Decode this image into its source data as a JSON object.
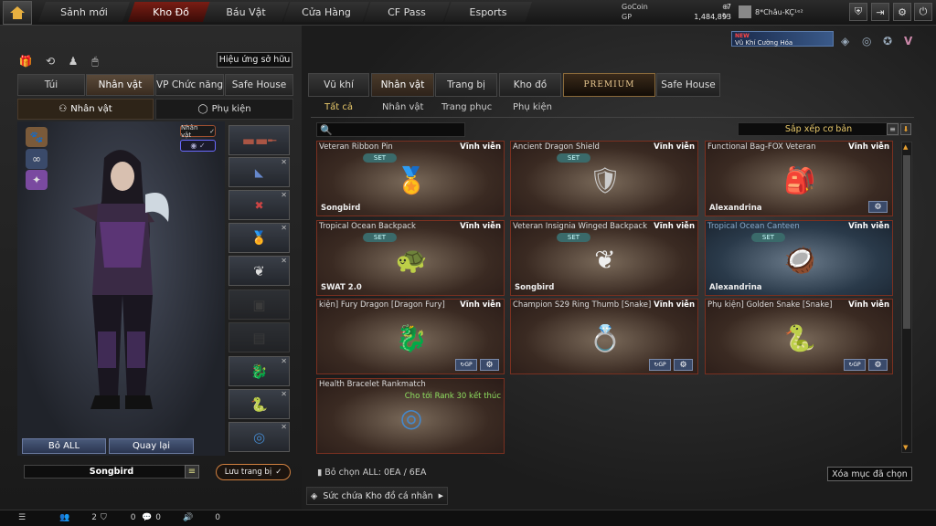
{
  "topnav": {
    "tabs": [
      {
        "label": "Sảnh mới"
      },
      {
        "label": "Kho Đồ"
      },
      {
        "label": "Báu Vật"
      },
      {
        "label": "Cửa Hàng"
      },
      {
        "label": "CF Pass"
      },
      {
        "label": "Esports"
      }
    ],
    "active_tab": "Kho Đồ"
  },
  "currency": {
    "gocoin_label": "GoCoin",
    "gocoin_value": "7",
    "gp_label": "GP",
    "gp_value": "1,484,893"
  },
  "player": {
    "name": "8*Châu-KÇ¹ᵉ²"
  },
  "promo": {
    "badge": "NEW",
    "label": "Vũ Khí Cường Hóa"
  },
  "left": {
    "effect_button": "Hiệu ứng sở hữu",
    "tabs": [
      "Túi",
      "Nhân vật",
      "VP Chức năng",
      "Safe House"
    ],
    "subtabs": [
      "Nhân vật",
      "Phụ kiện"
    ],
    "char_badge": "Nhân vật",
    "clear_all": "Bỏ ALL",
    "back": "Quay lại",
    "preset_name": "Songbird",
    "save": "Lưu trang bị"
  },
  "right": {
    "tabs": [
      "Vũ khí",
      "Nhân vật",
      "Trang bị",
      "Kho đồ"
    ],
    "premium": "PREMIUM",
    "safe_house": "Safe House",
    "subtabs": [
      "Tất cả",
      "Nhân vật",
      "Trang phục",
      "Phụ kiện"
    ],
    "sort": "Sắp xếp cơ bản",
    "select_count": "Bỏ chọn ALL: 0EA / 6EA",
    "clear_selected": "Xóa mục đã chọn",
    "capacity": "Sức chứa Kho đồ cá nhân"
  },
  "items": [
    {
      "name": "Veteran Ribbon Pin",
      "duration": "Vĩnh viễn",
      "set": "SET",
      "owner": "Songbird",
      "icon": "medal-icon"
    },
    {
      "name": "Ancient Dragon Shield",
      "duration": "Vĩnh viễn",
      "set": "SET",
      "owner": "",
      "icon": "shield-icon"
    },
    {
      "name": "Functional Bag-FOX Veteran",
      "duration": "Vĩnh viễn",
      "set": "",
      "owner": "Alexandrina",
      "icon": "backpack-icon"
    },
    {
      "name": "Tropical Ocean Backpack",
      "duration": "Vĩnh viễn",
      "set": "SET",
      "owner": "SWAT 2.0",
      "icon": "turtle-icon"
    },
    {
      "name": "Veteran Insignia Winged Backpack",
      "duration": "Vĩnh viễn",
      "set": "SET",
      "owner": "Songbird",
      "icon": "wings-icon"
    },
    {
      "name": "Tropical Ocean Canteen",
      "duration": "Vĩnh viễn",
      "set": "SET",
      "owner": "Alexandrina",
      "icon": "coconut-icon"
    },
    {
      "name": "kiện] Fury Dragon [Dragon Fury]",
      "duration": "Vĩnh viễn",
      "set": "",
      "owner": "",
      "icon": "dragon-icon"
    },
    {
      "name": "Champion S29 Ring Thumb [Snake]",
      "duration": "Vĩnh viễn",
      "set": "",
      "owner": "",
      "icon": "ring-icon"
    },
    {
      "name": "Phụ kiện] Golden Snake [Snake]",
      "duration": "Vĩnh viễn",
      "set": "",
      "owner": "",
      "icon": "snake-icon"
    },
    {
      "name": "Health Bracelet Rankmatch",
      "duration": "",
      "set": "",
      "owner": "",
      "note": "Cho tới Rank 30 kết thúc",
      "icon": "bracelet-icon"
    }
  ],
  "bottombar": {
    "count1": "2",
    "count2": "0",
    "count3": "0",
    "count4": "0"
  }
}
